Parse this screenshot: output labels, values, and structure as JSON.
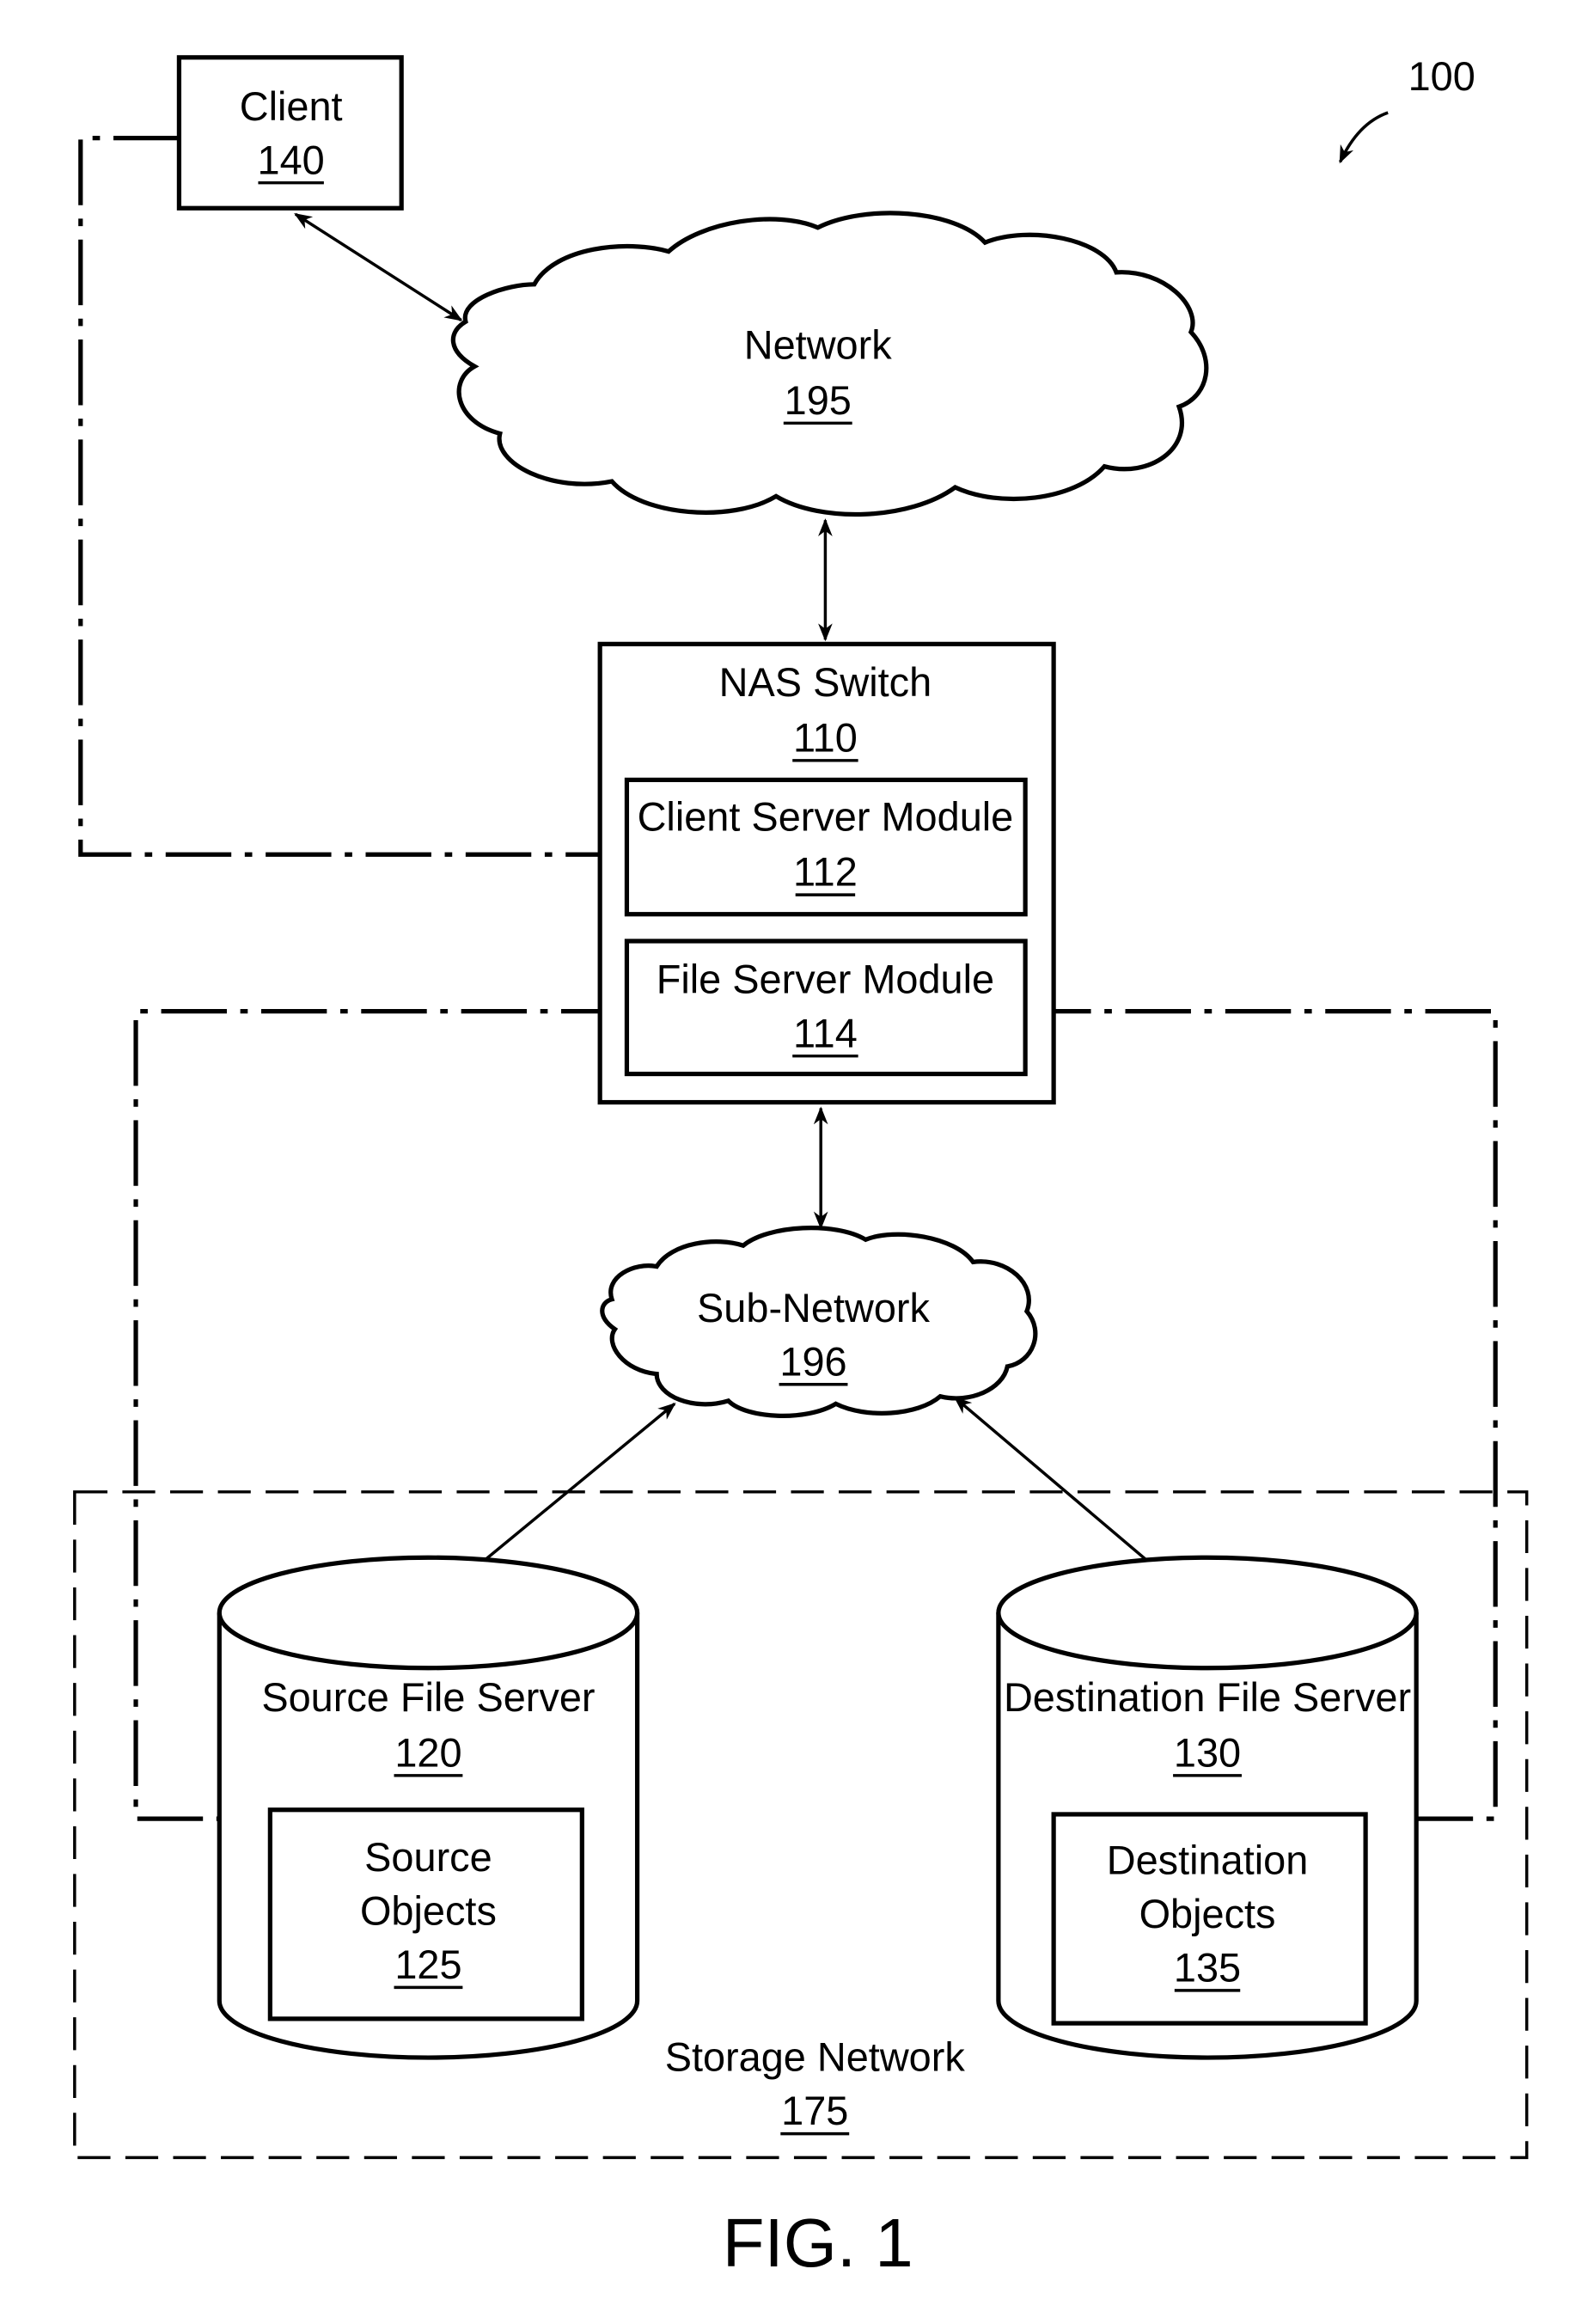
{
  "figure": {
    "reference": "100",
    "caption": "FIG. 1"
  },
  "nodes": {
    "client": {
      "label": "Client",
      "ref": "140"
    },
    "network": {
      "label": "Network",
      "ref": "195"
    },
    "nas_switch": {
      "label": "NAS Switch",
      "ref": "110"
    },
    "client_server_module": {
      "label": "Client Server Module",
      "ref": "112"
    },
    "file_server_module": {
      "label": "File Server Module",
      "ref": "114"
    },
    "sub_network": {
      "label": "Sub-Network",
      "ref": "196"
    },
    "source_file_server": {
      "label": "Source File Server",
      "ref": "120"
    },
    "source_objects": {
      "line1": "Source",
      "line2": "Objects",
      "ref": "125"
    },
    "destination_file_server": {
      "label": "Destination File Server",
      "ref": "130"
    },
    "destination_objects": {
      "line1": "Destination",
      "line2": "Objects",
      "ref": "135"
    },
    "storage_network": {
      "label": "Storage Network",
      "ref": "175"
    }
  },
  "edges": [
    {
      "from": "client",
      "to": "network",
      "type": "bidirectional-arrow"
    },
    {
      "from": "network",
      "to": "nas_switch",
      "type": "bidirectional-arrow"
    },
    {
      "from": "nas_switch",
      "to": "sub_network",
      "type": "bidirectional-arrow"
    },
    {
      "from": "sub_network",
      "to": "source_file_server",
      "type": "bidirectional-arrow"
    },
    {
      "from": "sub_network",
      "to": "destination_file_server",
      "type": "bidirectional-arrow"
    },
    {
      "from": "client",
      "to": "client_server_module",
      "type": "dash-dot-link"
    },
    {
      "from": "file_server_module",
      "to": "source_file_server",
      "type": "dash-dot-link"
    },
    {
      "from": "file_server_module",
      "to": "destination_file_server",
      "type": "dash-dot-link"
    }
  ]
}
